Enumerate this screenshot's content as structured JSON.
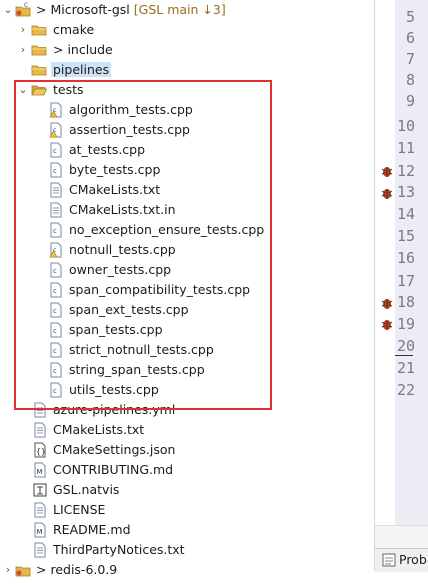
{
  "project": {
    "name": "Microsoft-gsl",
    "git_info": "[GSL main ↓3]"
  },
  "tree": [
    {
      "label": "cmake",
      "type": "folder"
    },
    {
      "label": "include",
      "type": "folder"
    },
    {
      "label": "pipelines",
      "type": "folder"
    },
    {
      "label": "tests",
      "type": "folder"
    },
    {
      "label": "algorithm_tests.cpp",
      "type": "cpp-warn"
    },
    {
      "label": "assertion_tests.cpp",
      "type": "cpp-warn"
    },
    {
      "label": "at_tests.cpp",
      "type": "cpp"
    },
    {
      "label": "byte_tests.cpp",
      "type": "cpp"
    },
    {
      "label": "CMakeLists.txt",
      "type": "txt"
    },
    {
      "label": "CMakeLists.txt.in",
      "type": "txt"
    },
    {
      "label": "no_exception_ensure_tests.cpp",
      "type": "cpp"
    },
    {
      "label": "notnull_tests.cpp",
      "type": "cpp-warn"
    },
    {
      "label": "owner_tests.cpp",
      "type": "cpp"
    },
    {
      "label": "span_compatibility_tests.cpp",
      "type": "cpp"
    },
    {
      "label": "span_ext_tests.cpp",
      "type": "cpp"
    },
    {
      "label": "span_tests.cpp",
      "type": "cpp"
    },
    {
      "label": "strict_notnull_tests.cpp",
      "type": "cpp"
    },
    {
      "label": "string_span_tests.cpp",
      "type": "cpp"
    },
    {
      "label": "utils_tests.cpp",
      "type": "cpp"
    },
    {
      "label": "azure-pipelines.yml",
      "type": "yml"
    },
    {
      "label": "CMakeLists.txt",
      "type": "txt"
    },
    {
      "label": "CMakeSettings.json",
      "type": "json"
    },
    {
      "label": "CONTRIBUTING.md",
      "type": "md"
    },
    {
      "label": "GSL.natvis",
      "type": "natvis"
    },
    {
      "label": "LICENSE",
      "type": "txt"
    },
    {
      "label": "README.md",
      "type": "md"
    },
    {
      "label": "ThirdPartyNotices.txt",
      "type": "txt"
    },
    {
      "label": "redis-6.0.9",
      "type": "project"
    }
  ],
  "line_numbers": [
    "5",
    "6",
    "7",
    "8",
    "9",
    "10",
    "11",
    "12",
    "13",
    "14",
    "15",
    "16",
    "17",
    "18",
    "19",
    "20",
    "21",
    "22"
  ],
  "bottom_tab": {
    "label": "Prob"
  },
  "colors": {
    "highlight_border": "#e03030",
    "folder": "#e8b84a",
    "selection": "#cde3f7",
    "bug": "#b5442b"
  }
}
